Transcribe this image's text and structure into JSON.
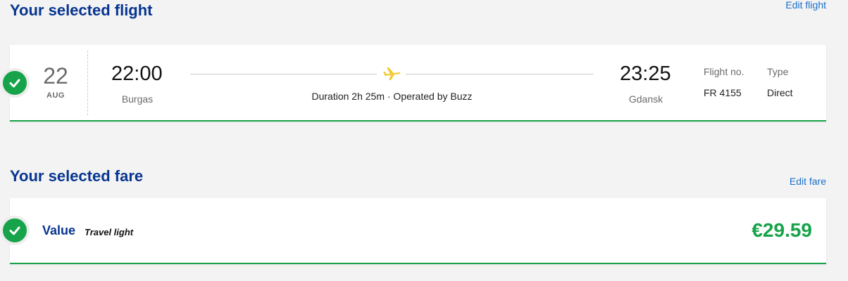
{
  "flight_section": {
    "title": "Your selected flight",
    "edit_label": "Edit flight"
  },
  "flight": {
    "day": "22",
    "month": "AUG",
    "depart_time": "22:00",
    "depart_city": "Burgas",
    "arrive_time": "23:25",
    "arrive_city": "Gdansk",
    "duration_text": "Duration 2h 25m · Operated by Buzz",
    "flight_no_label": "Flight no.",
    "flight_no": "FR 4155",
    "type_label": "Type",
    "type": "Direct"
  },
  "fare_section": {
    "title": "Your selected fare",
    "edit_label": "Edit fare"
  },
  "fare": {
    "name": "Value",
    "tagline": "Travel light",
    "price": "€29.59"
  },
  "colors": {
    "brand_blue": "#073590",
    "link_blue": "#1c6fc9",
    "success_green": "#16a34a",
    "plane_yellow": "#f1c933"
  },
  "icons": {
    "check": "check-icon",
    "plane": "plane-icon"
  }
}
